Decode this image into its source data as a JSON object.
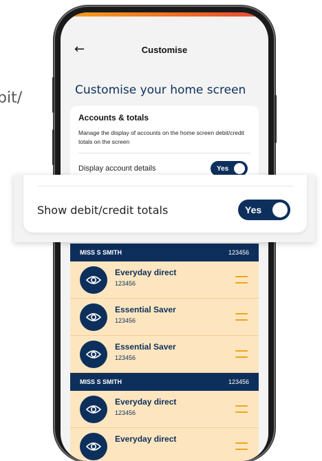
{
  "background": {
    "partial_text": "bit/"
  },
  "header": {
    "back_icon": "arrow-left-icon",
    "title": "Customise"
  },
  "page": {
    "heading": "Customise your home screen"
  },
  "accounts_card": {
    "title": "Accounts & totals",
    "description": "Manage the display of accounts on the home screen debit/credit totals on the screen",
    "display_account_details": {
      "label": "Display account details",
      "toggle_label": "Yes",
      "on": true
    }
  },
  "zoomed_setting": {
    "label": "Show debit/credit totals",
    "toggle_label": "Yes",
    "on": true
  },
  "groups": [
    {
      "holder": "MISS S SMITH",
      "number": "123456",
      "accounts": [
        {
          "name": "Everyday direct",
          "number": "123456"
        },
        {
          "name": "Essential Saver",
          "number": "123456"
        },
        {
          "name": "Essential Saver",
          "number": "123456"
        }
      ]
    },
    {
      "holder": "MISS S SMITH",
      "number": "123456",
      "accounts": [
        {
          "name": "Everyday direct",
          "number": "123456"
        },
        {
          "name": "Everyday direct",
          "number": ""
        }
      ]
    }
  ],
  "colors": {
    "navy": "#0d2f5c",
    "account_row": "#fde6bf",
    "drag_handle": "#f0a21a",
    "accent_gradient": [
      "#f4a31c",
      "#e8483b"
    ]
  }
}
